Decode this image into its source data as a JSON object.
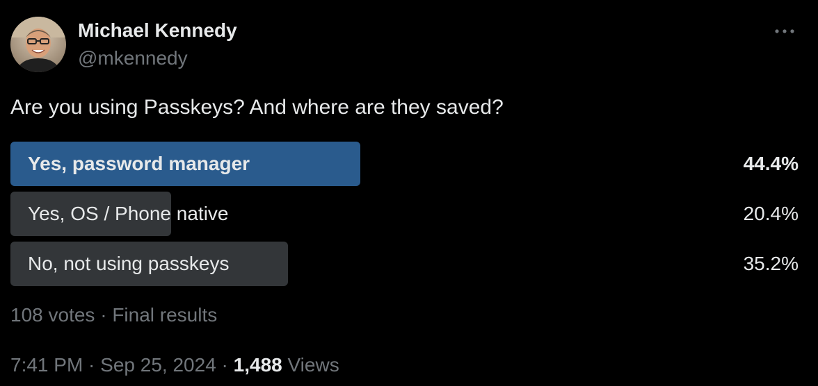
{
  "author": {
    "name": "Michael Kennedy",
    "handle": "@mkennedy",
    "avatar_icon": "person-avatar"
  },
  "more_icon": "ellipsis-icon",
  "tweet": {
    "text": "Are you using Passkeys? And where are they saved?"
  },
  "poll": {
    "options": [
      {
        "label": "Yes, password manager",
        "percent": "44.4%",
        "value": 44.4,
        "winner": true
      },
      {
        "label": "Yes, OS / Phone native",
        "percent": "20.4%",
        "value": 20.4,
        "winner": false
      },
      {
        "label": "No, not using passkeys",
        "percent": "35.2%",
        "value": 35.2,
        "winner": false
      }
    ],
    "votes": "108 votes",
    "separator": " · ",
    "status": "Final results"
  },
  "meta": {
    "time": "7:41 PM",
    "date": "Sep 25, 2024",
    "separator": " · ",
    "views_count": "1,488",
    "views_label": " Views"
  },
  "colors": {
    "background": "#000000",
    "text": "#e7e9ea",
    "muted": "#71767b",
    "winner_bar": "#2a5b8d",
    "bar": "#333639"
  }
}
